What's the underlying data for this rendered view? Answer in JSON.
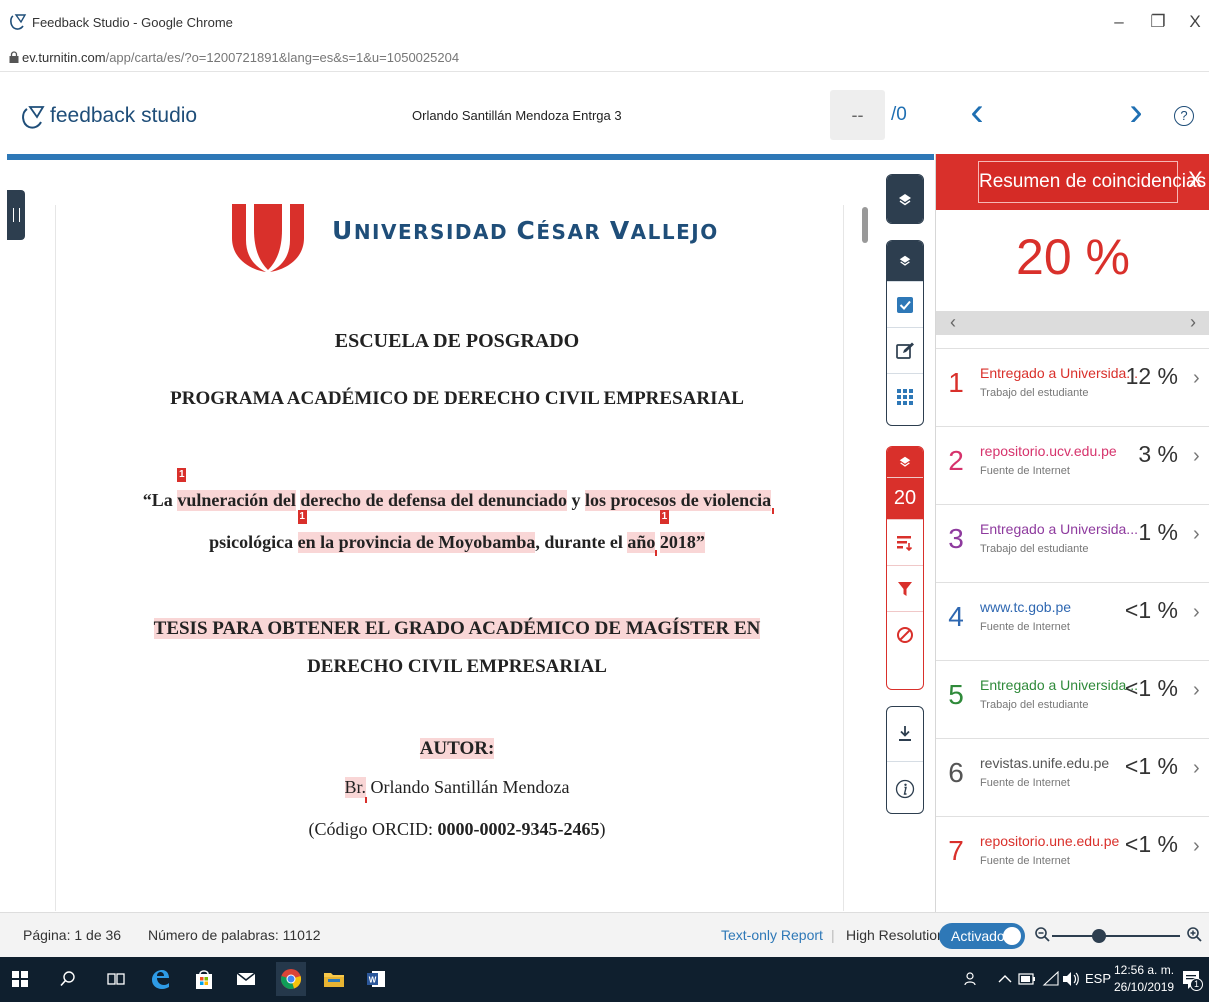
{
  "window": {
    "title": "Feedback Studio - Google Chrome",
    "minimize": "–",
    "maximize": "❐",
    "close": "X"
  },
  "address": {
    "host": "ev.turnitin.com",
    "path": "/app/carta/es/?o=1200721891&lang=es&s=1&u=1050025204"
  },
  "header": {
    "brand": "feedback studio",
    "doc_title": "Orlando Santillán Mendoza Entrga 3",
    "page_input": "--",
    "page_total": "/0",
    "prev": "‹",
    "next": "›",
    "help": "?"
  },
  "document": {
    "university_line": [
      "U",
      "NIVERSIDAD ",
      "C",
      "ÉSAR ",
      "V",
      "ALLEJO"
    ],
    "school": "ESCUELA DE POSGRADO",
    "program": "PROGRAMA ACADÉMICO DE DERECHO CIVIL EMPRESARIAL",
    "title_line1": {
      "p1": "“La ",
      "h1": "vulneración del",
      "p2": " ",
      "h2": "derecho de defensa del denunciado",
      "p3": " y ",
      "h3": "los procesos de violencia"
    },
    "title_line2": {
      "p1": "psicológica ",
      "h1": "en la provincia de Moyobamba",
      "p2": ", durante el ",
      "h2": "año",
      "p3": " ",
      "h3": "2018”"
    },
    "badge": "1",
    "thesis_line1": "TESIS PARA OBTENER EL GRADO ACADÉMICO DE MAGÍSTER EN",
    "thesis_line2": "DERECHO CIVIL EMPRESARIAL",
    "author_label": "AUTOR:",
    "author_prefix": "Br.",
    "author_name": " Orlando Santillán Mendoza",
    "orcid_prefix": "(Código ORCID: ",
    "orcid": "0000-0002-9345-2465",
    "orcid_suffix": ")"
  },
  "toolbar": {
    "similarity_count": "20"
  },
  "panel": {
    "title": "Resumen de coincidencias",
    "close": "X",
    "overall": "20 %",
    "nav_prev": "‹",
    "nav_next": "›",
    "sources": [
      {
        "num": "1",
        "name": "Entregado a Universida...",
        "type": "Trabajo del estudiante",
        "pct": "12 %",
        "color": "#d9302b"
      },
      {
        "num": "2",
        "name": "repositorio.ucv.edu.pe",
        "type": "Fuente de Internet",
        "pct": "3 %",
        "color": "#d6336c"
      },
      {
        "num": "3",
        "name": "Entregado a Universida...",
        "type": "Trabajo del estudiante",
        "pct": "1 %",
        "color": "#8e3a9e"
      },
      {
        "num": "4",
        "name": "www.tc.gob.pe",
        "type": "Fuente de Internet",
        "pct": "<1 %",
        "color": "#2e67b1"
      },
      {
        "num": "5",
        "name": "Entregado a Universida...",
        "type": "Trabajo del estudiante",
        "pct": "<1 %",
        "color": "#2f8a3a"
      },
      {
        "num": "6",
        "name": "revistas.unife.edu.pe",
        "type": "Fuente de Internet",
        "pct": "<1 %",
        "color": "#555555"
      },
      {
        "num": "7",
        "name": "repositorio.une.edu.pe",
        "type": "Fuente de Internet",
        "pct": "<1 %",
        "color": "#d9302b"
      }
    ]
  },
  "status": {
    "page": "Página: 1 de 36",
    "words": "Número de palabras: 11012",
    "text_only": "Text-only Report",
    "separator": "|",
    "high_res": "High Resolution",
    "toggle": "Activado"
  },
  "taskbar": {
    "tray": "ESP",
    "time": "12:56 a. m.",
    "date": "26/10/2019",
    "notif": "1"
  },
  "colors": {
    "accent": "#2e78b7",
    "match_red": "#d9302b",
    "navy": "#1f4e79"
  }
}
